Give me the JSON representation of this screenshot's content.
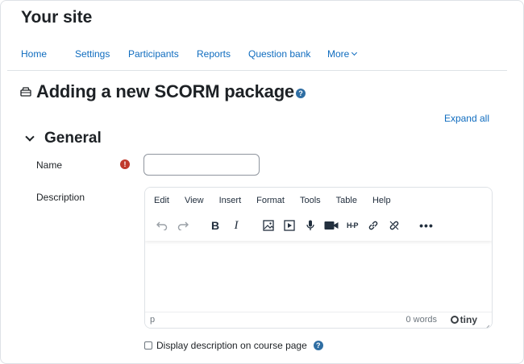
{
  "site": {
    "title": "Your site"
  },
  "nav": {
    "items": [
      "Home",
      "Settings",
      "Participants",
      "Reports",
      "Question bank",
      "More"
    ]
  },
  "page": {
    "title": "Adding a new SCORM package",
    "help_glyph": "?"
  },
  "form": {
    "expand_all": "Expand all",
    "section_title": "General",
    "name_label": "Name",
    "required_glyph": "!",
    "name_value": "",
    "description_label": "Description",
    "display_description_label": "Display description on course page"
  },
  "editor": {
    "menu": [
      "Edit",
      "View",
      "Insert",
      "Format",
      "Tools",
      "Table",
      "Help"
    ],
    "toolbar": [
      "undo-icon",
      "redo-icon",
      "bold-icon",
      "italic-icon",
      "image-icon",
      "media-icon",
      "record-audio-icon",
      "record-video-icon",
      "h5p-icon",
      "link-icon",
      "unlink-icon",
      "more-icon"
    ],
    "bold_glyph": "B",
    "italic_glyph": "I",
    "h5p_glyph": "H-P",
    "more_glyph": "•••",
    "status_path": "p",
    "word_count": "0 words",
    "brand": "tiny"
  },
  "colors": {
    "link": "#0f6cbf",
    "help": "#2f6ea3",
    "required": "#c0392b",
    "text": "#1d2125"
  }
}
